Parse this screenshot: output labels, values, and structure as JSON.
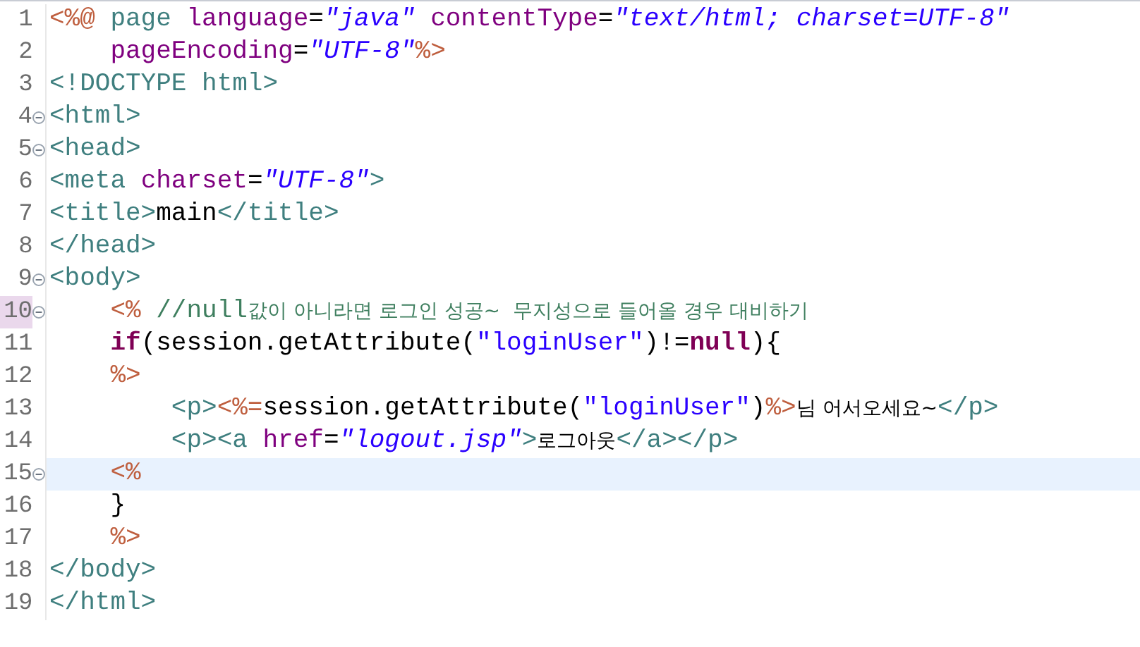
{
  "editor": {
    "lines": [
      {
        "number": "1",
        "foldable": false,
        "current": false,
        "marked": false,
        "tokens": [
          {
            "kind": "delim",
            "text": "<%@"
          },
          {
            "kind": "tag",
            "text": " page "
          },
          {
            "kind": "attr",
            "text": "language"
          },
          {
            "kind": "plain",
            "text": "="
          },
          {
            "kind": "string",
            "text": "\"java\" "
          },
          {
            "kind": "attr",
            "text": "contentType"
          },
          {
            "kind": "plain",
            "text": "="
          },
          {
            "kind": "string",
            "text": "\"text/html; charset=UTF-8\""
          }
        ]
      },
      {
        "number": "2",
        "foldable": false,
        "current": false,
        "marked": false,
        "tokens": [
          {
            "kind": "attr",
            "text": "    pageEncoding"
          },
          {
            "kind": "plain",
            "text": "="
          },
          {
            "kind": "string",
            "text": "\"UTF-8\""
          },
          {
            "kind": "delim",
            "text": "%>"
          }
        ]
      },
      {
        "number": "3",
        "foldable": false,
        "current": false,
        "marked": false,
        "tokens": [
          {
            "kind": "tag",
            "text": "<!DOCTYPE html>"
          }
        ]
      },
      {
        "number": "4",
        "foldable": true,
        "current": false,
        "marked": false,
        "tokens": [
          {
            "kind": "tag",
            "text": "<html>"
          }
        ]
      },
      {
        "number": "5",
        "foldable": true,
        "current": false,
        "marked": false,
        "tokens": [
          {
            "kind": "tag",
            "text": "<head>"
          }
        ]
      },
      {
        "number": "6",
        "foldable": false,
        "current": false,
        "marked": false,
        "tokens": [
          {
            "kind": "tag",
            "text": "<meta "
          },
          {
            "kind": "attr",
            "text": "charset"
          },
          {
            "kind": "plain",
            "text": "="
          },
          {
            "kind": "string",
            "text": "\"UTF-8\""
          },
          {
            "kind": "tag",
            "text": ">"
          }
        ]
      },
      {
        "number": "7",
        "foldable": false,
        "current": false,
        "marked": false,
        "tokens": [
          {
            "kind": "tag",
            "text": "<title>"
          },
          {
            "kind": "plain",
            "text": "main"
          },
          {
            "kind": "tag",
            "text": "</title>"
          }
        ]
      },
      {
        "number": "8",
        "foldable": false,
        "current": false,
        "marked": false,
        "tokens": [
          {
            "kind": "tag",
            "text": "</head>"
          }
        ]
      },
      {
        "number": "9",
        "foldable": true,
        "current": false,
        "marked": false,
        "tokens": [
          {
            "kind": "tag",
            "text": "<body>"
          }
        ]
      },
      {
        "number": "10",
        "foldable": true,
        "current": false,
        "marked": true,
        "tokens": [
          {
            "kind": "delim",
            "text": "    <% "
          },
          {
            "kind": "comment",
            "text": "//null"
          },
          {
            "kind": "comment-kr",
            "text": "값이 아니라면 로그인 성공~  무지성으로 들어올 경우 대비하기"
          }
        ]
      },
      {
        "number": "11",
        "foldable": false,
        "current": false,
        "marked": false,
        "tokens": [
          {
            "kind": "keyword",
            "text": "    if"
          },
          {
            "kind": "plain",
            "text": "(session.getAttribute("
          },
          {
            "kind": "jstring",
            "text": "\"loginUser\""
          },
          {
            "kind": "plain",
            "text": ")!="
          },
          {
            "kind": "keyword",
            "text": "null"
          },
          {
            "kind": "plain",
            "text": "){"
          }
        ]
      },
      {
        "number": "12",
        "foldable": false,
        "current": false,
        "marked": false,
        "tokens": [
          {
            "kind": "delim",
            "text": "    %>"
          }
        ]
      },
      {
        "number": "13",
        "foldable": false,
        "current": false,
        "marked": false,
        "tokens": [
          {
            "kind": "tag",
            "text": "        <p>"
          },
          {
            "kind": "delim",
            "text": "<%="
          },
          {
            "kind": "plain",
            "text": "session.getAttribute("
          },
          {
            "kind": "jstring",
            "text": "\"loginUser\""
          },
          {
            "kind": "plain",
            "text": ")"
          },
          {
            "kind": "delim",
            "text": "%>"
          },
          {
            "kind": "text-kr",
            "text": "님 어서오세요~"
          },
          {
            "kind": "tag",
            "text": "</p>"
          }
        ]
      },
      {
        "number": "14",
        "foldable": false,
        "current": false,
        "marked": false,
        "tokens": [
          {
            "kind": "tag",
            "text": "        <p><a "
          },
          {
            "kind": "attr",
            "text": "href"
          },
          {
            "kind": "plain",
            "text": "="
          },
          {
            "kind": "string",
            "text": "\"logout.jsp\""
          },
          {
            "kind": "tag",
            "text": ">"
          },
          {
            "kind": "text-kr",
            "text": "로그아웃"
          },
          {
            "kind": "tag",
            "text": "</a></p>"
          }
        ]
      },
      {
        "number": "15",
        "foldable": true,
        "current": true,
        "marked": false,
        "tokens": [
          {
            "kind": "delim",
            "text": "    <%"
          }
        ]
      },
      {
        "number": "16",
        "foldable": false,
        "current": false,
        "marked": false,
        "tokens": [
          {
            "kind": "plain",
            "text": "    }"
          }
        ]
      },
      {
        "number": "17",
        "foldable": false,
        "current": false,
        "marked": false,
        "tokens": [
          {
            "kind": "delim",
            "text": "    %>"
          }
        ]
      },
      {
        "number": "18",
        "foldable": false,
        "current": false,
        "marked": false,
        "tokens": [
          {
            "kind": "tag",
            "text": "</body>"
          }
        ]
      },
      {
        "number": "19",
        "foldable": false,
        "current": false,
        "marked": false,
        "tokens": [
          {
            "kind": "tag",
            "text": "</html>"
          }
        ]
      }
    ]
  }
}
